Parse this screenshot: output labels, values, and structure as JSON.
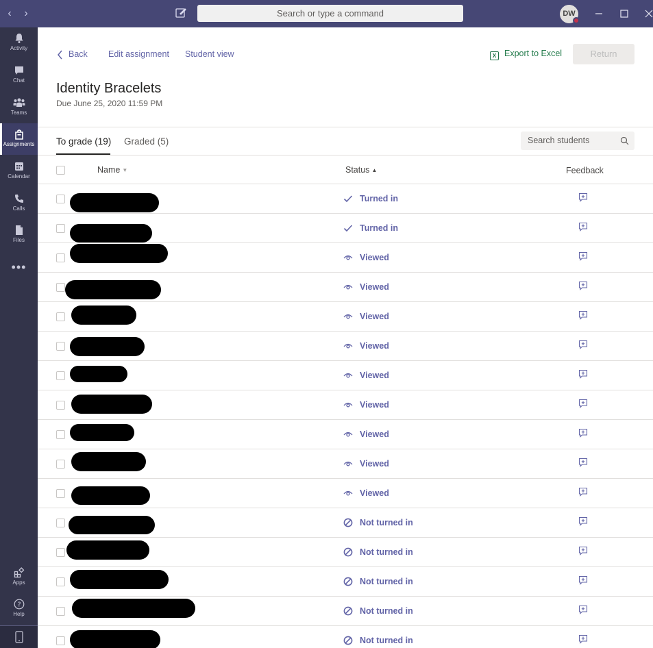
{
  "titlebar": {
    "search_placeholder": "Search or type a command",
    "avatar_initials": "DW"
  },
  "rail": {
    "items": [
      {
        "label": "Activity",
        "icon": "bell-icon"
      },
      {
        "label": "Chat",
        "icon": "chat-icon"
      },
      {
        "label": "Teams",
        "icon": "teams-icon"
      },
      {
        "label": "Assignments",
        "icon": "assignments-icon",
        "active": true
      },
      {
        "label": "Calendar",
        "icon": "calendar-icon"
      },
      {
        "label": "Calls",
        "icon": "phone-icon"
      },
      {
        "label": "Files",
        "icon": "files-icon"
      }
    ],
    "more": "•••",
    "apps_label": "Apps",
    "help_label": "Help"
  },
  "nav": {
    "back": "Back",
    "edit_assignment": "Edit assignment",
    "student_view": "Student view",
    "export": "Export to Excel",
    "return": "Return"
  },
  "assignment": {
    "title": "Identity Bracelets",
    "due": "Due June 25, 2020 11:59 PM"
  },
  "tabs": [
    {
      "label": "To grade (19)",
      "active": true
    },
    {
      "label": "Graded (5)",
      "active": false
    }
  ],
  "search_students_placeholder": "Search students",
  "columns": {
    "name": "Name",
    "status": "Status",
    "feedback": "Feedback"
  },
  "rows": [
    {
      "status": "Turned in",
      "type": "turned"
    },
    {
      "status": "Turned in",
      "type": "turned"
    },
    {
      "status": "Viewed",
      "type": "viewed"
    },
    {
      "status": "Viewed",
      "type": "viewed"
    },
    {
      "status": "Viewed",
      "type": "viewed"
    },
    {
      "status": "Viewed",
      "type": "viewed"
    },
    {
      "status": "Viewed",
      "type": "viewed"
    },
    {
      "status": "Viewed",
      "type": "viewed"
    },
    {
      "status": "Viewed",
      "type": "viewed"
    },
    {
      "status": "Viewed",
      "type": "viewed"
    },
    {
      "status": "Viewed",
      "type": "viewed"
    },
    {
      "status": "Not turned in",
      "type": "notturned"
    },
    {
      "status": "Not turned in",
      "type": "notturned"
    },
    {
      "status": "Not turned in",
      "type": "notturned"
    },
    {
      "status": "Not turned in",
      "type": "notturned"
    },
    {
      "status": "Not turned in",
      "type": "notturned"
    }
  ],
  "colors": {
    "accent": "#6264a7",
    "titlebar": "#464775",
    "rail": "#33344a",
    "excel": "#237b4b"
  }
}
